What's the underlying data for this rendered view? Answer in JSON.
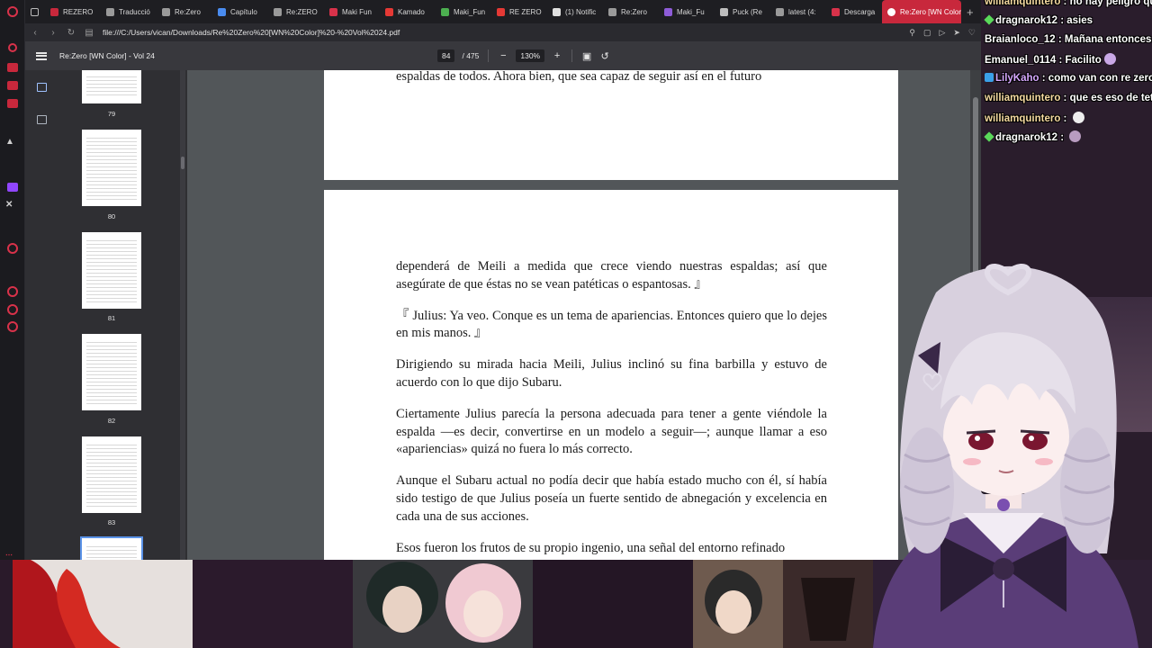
{
  "browser": {
    "tabs": [
      {
        "label": "REZERO",
        "color": "#c8283c"
      },
      {
        "label": "Traducció",
        "color": "#9a9a9a"
      },
      {
        "label": "Re:Zero",
        "color": "#9a9a9a"
      },
      {
        "label": "Capítulo",
        "color": "#4a8cf0"
      },
      {
        "label": "Re:ZERO",
        "color": "#9a9a9a"
      },
      {
        "label": "Maki Fun",
        "color": "#d8324a"
      },
      {
        "label": "Kamado",
        "color": "#e53935"
      },
      {
        "label": "Maki_Fun",
        "color": "#4caf50"
      },
      {
        "label": "RE ZERO",
        "color": "#e53935"
      },
      {
        "label": "(1) Notific",
        "color": "#e0e0e0"
      },
      {
        "label": "Re:Zero",
        "color": "#9a9a9a"
      },
      {
        "label": "Maki_Fu",
        "color": "#8e5cd8"
      },
      {
        "label": "Puck (Re",
        "color": "#bdbdbd"
      },
      {
        "label": "latest (4:",
        "color": "#9a9a9a"
      },
      {
        "label": "Descarga",
        "color": "#d8324a"
      },
      {
        "label": "Re:Zero [WN Color]",
        "color": "#ffffff"
      }
    ],
    "url": "file:///C:/Users/vican/Downloads/Re%20Zero%20[WN%20Color]%20-%20Vol%2024.pdf",
    "new_tab": "+"
  },
  "pdf": {
    "title": "Re:Zero [WN Color] - Vol 24",
    "current_page": "84",
    "total_pages": "/ 475",
    "zoom": "130%",
    "thumbnails": [
      "79",
      "80",
      "81",
      "82",
      "83"
    ],
    "top_page_text": "espaldas de todos. Ahora bien, que sea capaz de seguir así en el futuro",
    "paragraphs": [
      "dependerá de Meili a medida que crece viendo nuestras espaldas; así que asegúrate de que éstas no se vean patéticas o espantosas. 』",
      "『 Julius: Ya veo. Conque es un tema de apariencias. Entonces quiero que lo dejes en mis manos. 』",
      "Dirigiendo su mirada hacia Meili, Julius inclinó su fina barbilla y estuvo de acuerdo con lo que dijo Subaru.",
      "Ciertamente Julius parecía la persona adecuada para tener a gente viéndole la espalda —es decir, convertirse en un modelo a seguir—; aunque llamar a eso «apariencias» quizá no fuera lo más correcto.",
      "Aunque el Subaru actual no podía decir que había estado mucho con él, sí había sido testigo de que Julius poseía un fuerte sentido de abnegación y excelencia en cada una de sus acciones.",
      "Esos fueron los frutos de su propio ingenio, una señal del entorno refinado"
    ]
  },
  "chat": [
    {
      "user": "williamquintero",
      "msg": "no hay peligro qu",
      "user_color": "#f4d9a0",
      "badge": "none"
    },
    {
      "user": "dragnarok12",
      "msg": "asies",
      "user_color": "#ffffff",
      "badge": "diamond"
    },
    {
      "user": "Braianloco_12",
      "msg": "Mañana entonces",
      "user_color": "#ffffff",
      "badge": "none"
    },
    {
      "user": "Emanuel_0114",
      "msg": "Facilito",
      "user_color": "#ffffff",
      "badge": "none"
    },
    {
      "user": "LilyKaho",
      "msg": "como van con re zero",
      "user_color": "#d7a8ff",
      "badge": "square"
    },
    {
      "user": "williamquintero",
      "msg": "que es eso de tet",
      "user_color": "#f4d9a0",
      "badge": "none"
    },
    {
      "user": "williamquintero",
      "msg": "",
      "user_color": "#f4d9a0",
      "badge": "none"
    },
    {
      "user": "dragnarok12",
      "msg": "",
      "user_color": "#ffffff",
      "badge": "diamond"
    }
  ],
  "colors": {
    "opera_red": "#c8283c",
    "pdf_bg": "#525659",
    "toolbar": "#38383d"
  }
}
